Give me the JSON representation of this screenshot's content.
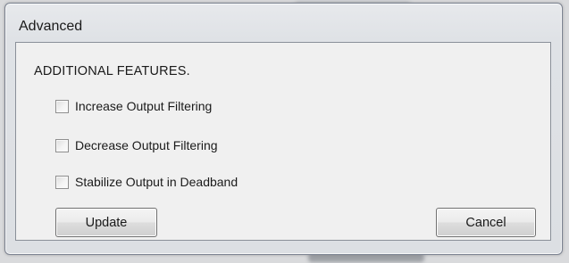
{
  "window": {
    "title": "Advanced"
  },
  "section": {
    "heading": "ADDITIONAL FEATURES."
  },
  "options": [
    {
      "label": "Increase Output Filtering",
      "checked": false
    },
    {
      "label": "Decrease Output Filtering",
      "checked": false
    },
    {
      "label": "Stabilize Output in Deadband",
      "checked": false
    }
  ],
  "buttons": {
    "update_label": "Update",
    "cancel_label": "Cancel"
  },
  "colors": {
    "window_frame": "#dfe2e6",
    "client_background": "#f0f0f0",
    "border": "#8a9099"
  }
}
